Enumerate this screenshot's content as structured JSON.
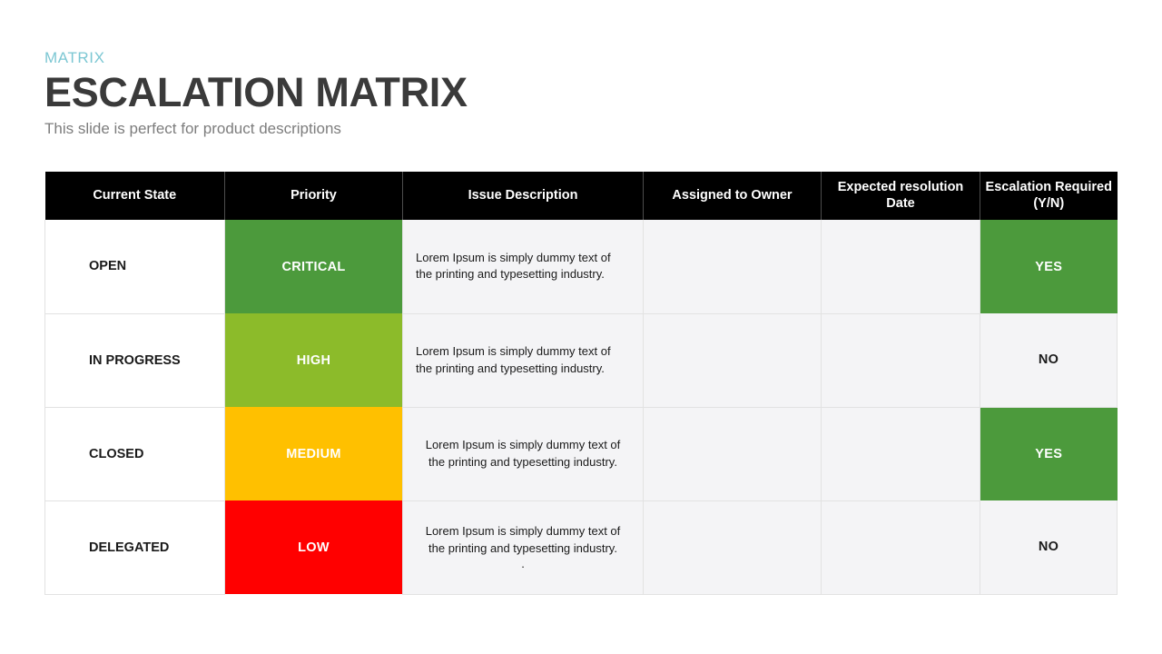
{
  "header": {
    "eyebrow": "MATRIX",
    "title": "ESCALATION MATRIX",
    "subtitle": "This slide is perfect for product descriptions"
  },
  "colors": {
    "eyebrow": "#7CC7D3",
    "title": "#3A3A3A",
    "subtitle": "#7D7D7D",
    "header_row_bg": "#000000",
    "cell_bg": "#f4f4f6",
    "critical": "#4C9A3C",
    "high": "#8CBB2A",
    "medium": "#FFC000",
    "low": "#FF0000",
    "yes": "#4C9A3C"
  },
  "table": {
    "columns": [
      "Current State",
      "Priority",
      "Issue Description",
      "Assigned to Owner",
      "Expected resolution Date",
      "Escalation Required (Y/N)"
    ],
    "rows": [
      {
        "state": "OPEN",
        "priority": "CRITICAL",
        "priority_color": "#4C9A3C",
        "description": "Lorem Ipsum is simply dummy text of the printing and typesetting industry.",
        "description_align": "align-left",
        "owner": "",
        "date": "",
        "escalation": "YES",
        "escalation_state": "yes",
        "escalation_color": "#4C9A3C"
      },
      {
        "state": "IN PROGRESS",
        "priority": "HIGH",
        "priority_color": "#8CBB2A",
        "description": "Lorem Ipsum is simply dummy text of the printing and typesetting industry.",
        "description_align": "align-left",
        "owner": "",
        "date": "",
        "escalation": "NO",
        "escalation_state": "no",
        "escalation_color": "#f4f4f6"
      },
      {
        "state": "CLOSED",
        "priority": "MEDIUM",
        "priority_color": "#FFC000",
        "description": "Lorem Ipsum is simply dummy text of the printing and typesetting industry.",
        "description_align": "align-center",
        "owner": "",
        "date": "",
        "escalation": "YES",
        "escalation_state": "yes",
        "escalation_color": "#4C9A3C"
      },
      {
        "state": "DELEGATED",
        "priority": "LOW",
        "priority_color": "#FF0000",
        "description": "Lorem Ipsum is simply dummy text of the printing and typesetting industry.",
        "description_trailing": ".",
        "description_align": "align-center",
        "owner": "",
        "date": "",
        "escalation": "NO",
        "escalation_state": "no",
        "escalation_color": "#f4f4f6"
      }
    ]
  }
}
